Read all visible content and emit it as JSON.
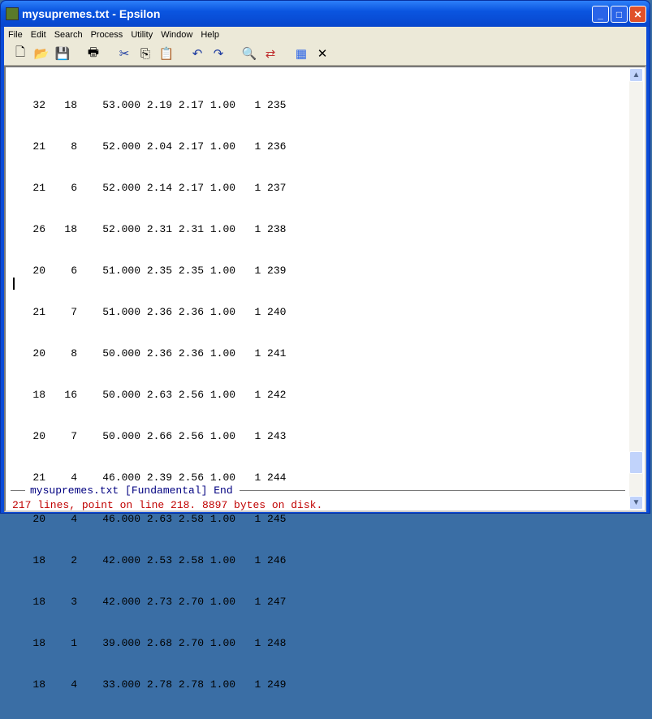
{
  "window": {
    "title": "mysupremes.txt - Epsilon"
  },
  "menu": [
    "File",
    "Edit",
    "Search",
    "Process",
    "Utility",
    "Window",
    "Help"
  ],
  "toolbar": [
    "new-file-icon",
    "open-folder-icon",
    "save-icon",
    "print-icon",
    "cut-icon",
    "copy-icon",
    "paste-icon",
    "undo-icon",
    "redo-icon",
    "find-icon",
    "replace-icon",
    "window-icon",
    "close-buffer-icon"
  ],
  "lines": [
    "   32   18    53.000 2.19 2.17 1.00   1 235",
    "   21    8    52.000 2.04 2.17 1.00   1 236",
    "   21    6    52.000 2.14 2.17 1.00   1 237",
    "   26   18    52.000 2.31 2.31 1.00   1 238",
    "   20    6    51.000 2.35 2.35 1.00   1 239",
    "   21    7    51.000 2.36 2.36 1.00   1 240",
    "   20    8    50.000 2.36 2.36 1.00   1 241",
    "   18   16    50.000 2.63 2.56 1.00   1 242",
    "   20    7    50.000 2.66 2.56 1.00   1 243",
    "   21    4    46.000 2.39 2.56 1.00   1 244",
    "   20    4    46.000 2.63 2.58 1.00   1 245",
    "   18    2    42.000 2.53 2.58 1.00   1 246",
    "   18    3    42.000 2.73 2.70 1.00   1 247",
    "   18    1    39.000 2.68 2.70 1.00   1 248",
    "   18    4    33.000 2.78 2.78 1.00   1 249"
  ],
  "modeline": "mysupremes.txt [Fundamental] End",
  "status": "217 lines, point on line 218.  8897 bytes on disk.",
  "scroll_position": 0.95
}
